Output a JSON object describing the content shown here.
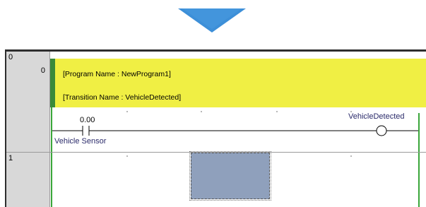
{
  "colors": {
    "arrow": "#3d8fd8",
    "comment_bg": "#f0ef44",
    "comment_marker": "#3a8a3a",
    "rail": "#3aa63a",
    "rung_number_bg": "#d8d8d8",
    "selection": "#8fa0bc"
  },
  "rungs": [
    {
      "number": "0",
      "step": "0",
      "comment": {
        "program_name": "[Program Name : NewProgram1]",
        "transition_name": "[Transition Name : VehicleDetected]"
      },
      "contact": {
        "address": "0.00",
        "label": "Vehicle Sensor"
      },
      "coil": {
        "label": "VehicleDetected"
      }
    },
    {
      "number": "1"
    }
  ],
  "icons": {
    "down_arrow": "chevron-down-arrow-icon",
    "contact": "normally-open-contact-icon",
    "coil": "output-coil-icon"
  }
}
